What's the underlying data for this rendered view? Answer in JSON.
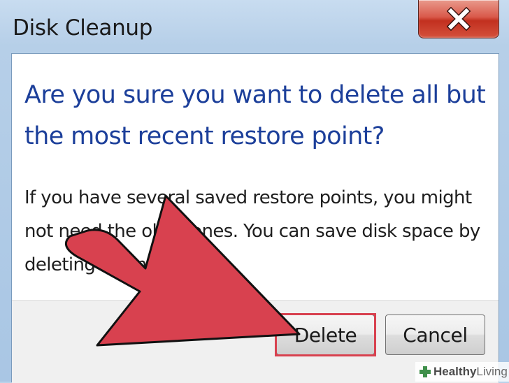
{
  "window": {
    "title": "Disk Cleanup",
    "close_icon": "close-icon"
  },
  "dialog": {
    "main_instruction": "Are you sure you want to delete all but the most recent restore point?",
    "body_text": "If you have several saved restore points, you might not need the older ones. You can save disk space by deleting them."
  },
  "buttons": {
    "delete_label": "Delete",
    "cancel_label": "Cancel"
  },
  "annotation": {
    "arrow_color": "#d8414f",
    "highlight_color": "#d8414f",
    "target": "delete-button"
  },
  "watermark": {
    "strong": "Healthy",
    "light": "Living"
  },
  "colors": {
    "instruction_text": "#1c3f9a",
    "close_button": "#c2301f",
    "frame": "#b6cfe8"
  }
}
